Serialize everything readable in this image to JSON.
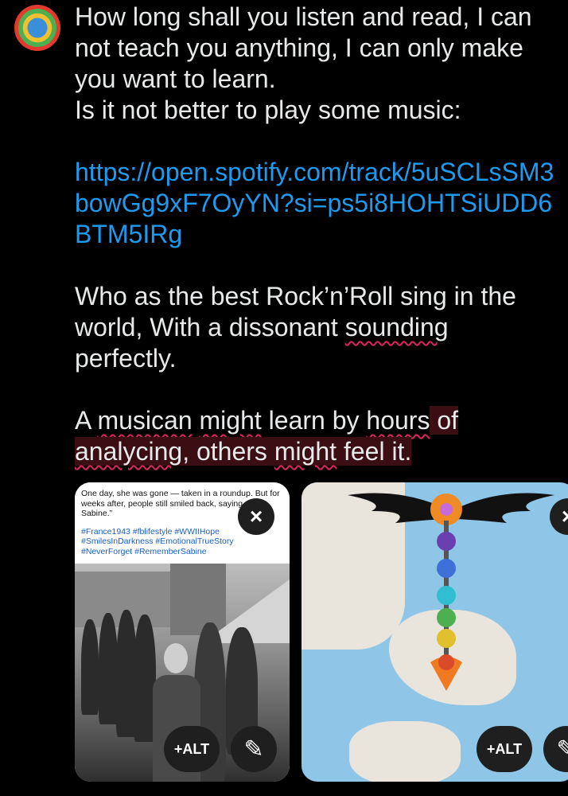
{
  "post": {
    "para1": "How long shall you listen and read, I can\nnot teach you anything, I can only make\nyou want to learn.\nIs it not better to play some music:",
    "link": "https://open.spotify.com/track/5uSCLsSM3bowGg9xF7OyYN?si=ps5i8HOHTSiUDD6BTM5IRg",
    "para2_a": "Who as the best Rock’n’Roll sing in the world, With a dissonant ",
    "para2_b": "sounding",
    "para2_c": "\nperfectly.",
    "para3_a": "A ",
    "para3_b": "musican",
    "para3_c": " ",
    "para3_d": "might",
    "para3_e": " learn by ",
    "para3_f": "hours",
    "para3_g": " of",
    "para3_h": "analycing",
    "para3_i": ", others ",
    "para3_j": "might",
    "para3_k": " feel it."
  },
  "media": {
    "left_caption": "One day, she was gone — taken in a roundup. But for weeks after, people still smiled back, saying, “For Sabine.”",
    "left_tags": "#France1943 #fblifestyle  #WWIIHope\n#SmilesInDarkness #EmotionalTrueStory\n#NeverForget #RememberSabine",
    "close_label": "×",
    "alt_label": "+ALT",
    "edit_icon": "✎"
  },
  "colors": {
    "link": "#1d9bf0",
    "spell": "#e0245e",
    "background": "#000000"
  }
}
